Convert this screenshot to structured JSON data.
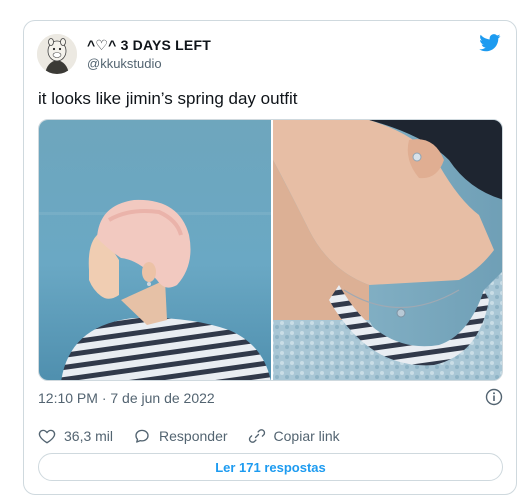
{
  "tweet": {
    "display_name": "^♡^ 3 DAYS LEFT",
    "handle": "@kkukstudio",
    "text": "it looks like jimin’s spring day outfit",
    "timestamp": "12:10 PM · 7 de jun de 2022",
    "media": {
      "left_image": "profile-of-person-with-pink-hair-and-striped-shirt-against-sea",
      "right_image": "close-up-of-neck-with-necklace-and-earring"
    }
  },
  "actions": {
    "like_count": "36,3 mil",
    "reply_label": "Responder",
    "copy_link_label": "Copiar link"
  },
  "replies_button": {
    "label": "Ler 171 respostas"
  },
  "icons": {
    "brand": "twitter-bird-icon",
    "info": "info-icon",
    "like": "heart-icon",
    "reply": "speech-bubble-icon",
    "copy": "link-icon"
  },
  "colors": {
    "accent": "#1d9bf0",
    "secondary_text": "#536471",
    "border": "#cfd9de"
  }
}
